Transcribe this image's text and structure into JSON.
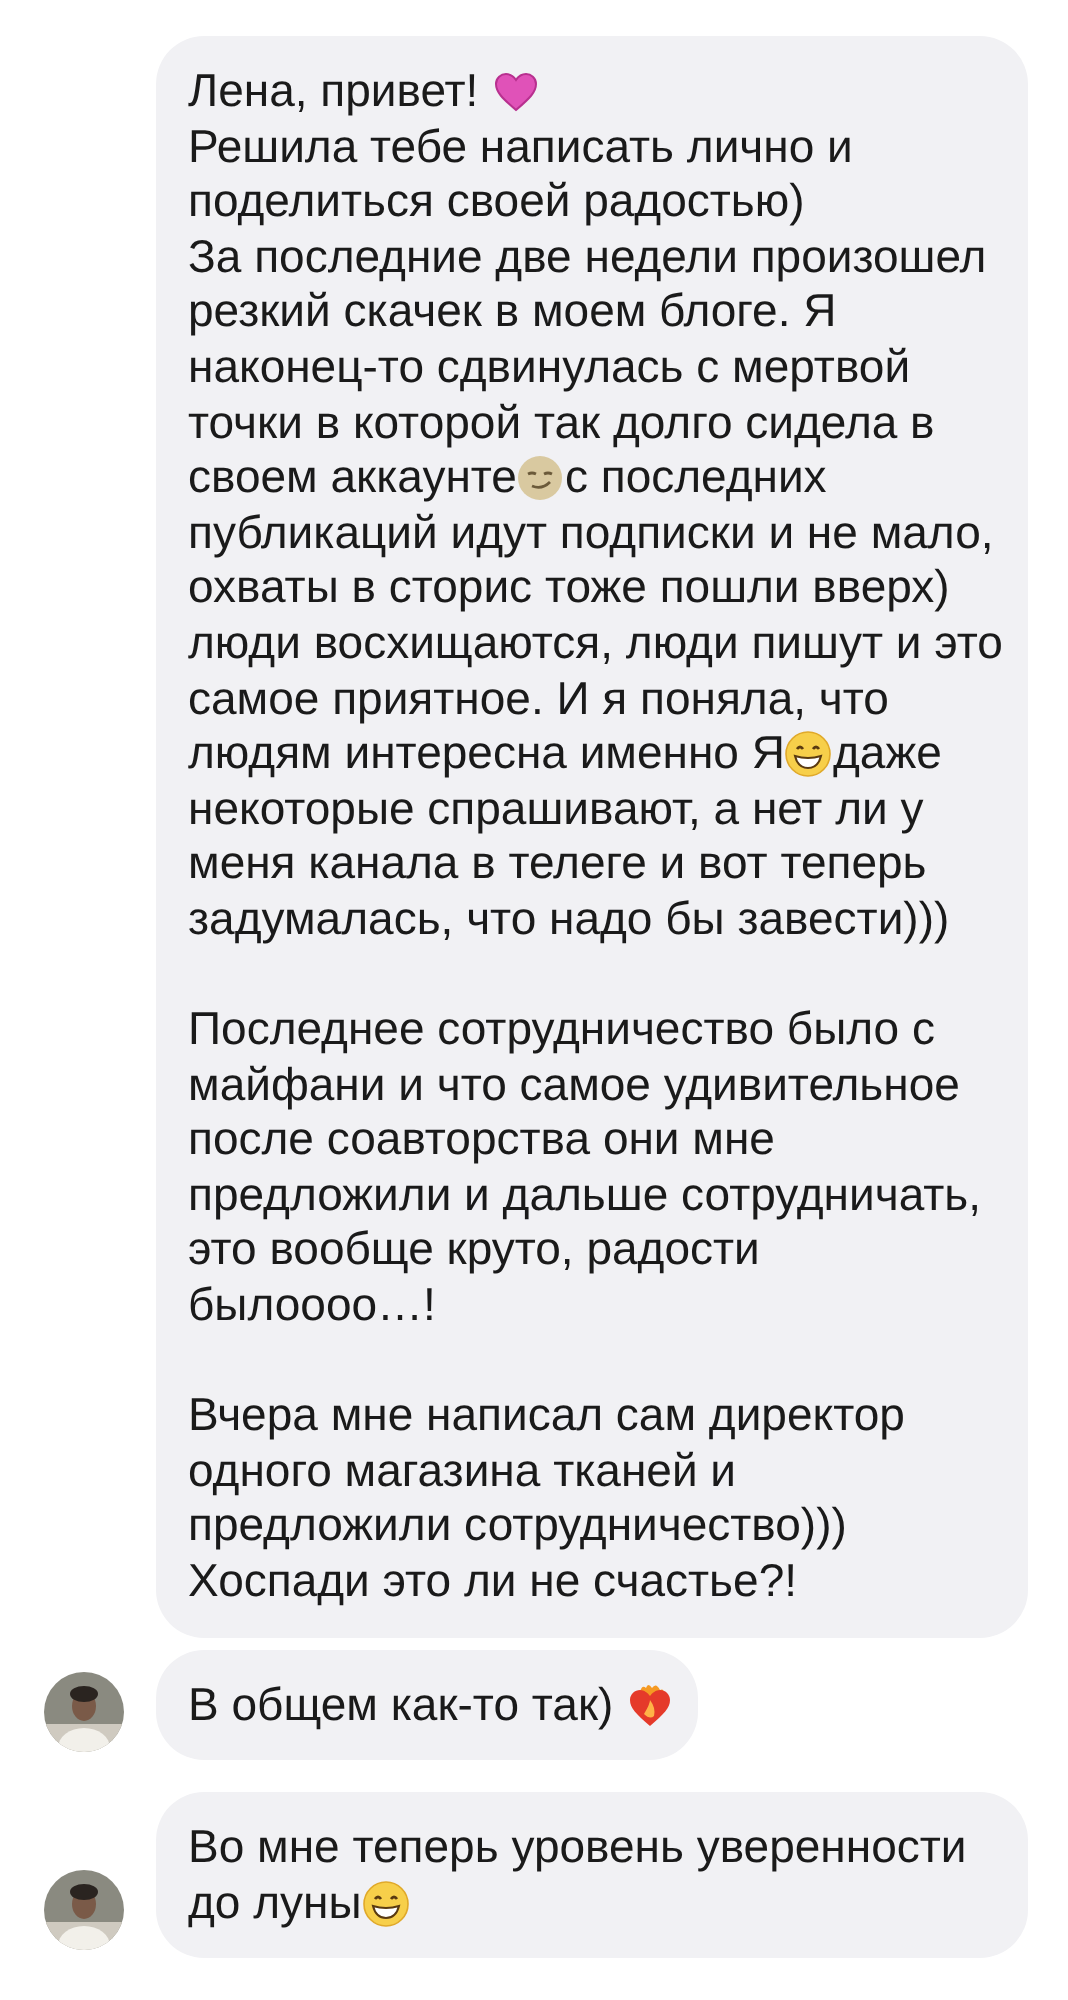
{
  "messages": [
    {
      "avatar": false,
      "segments": [
        {
          "kind": "text",
          "text": "Лена, привет! "
        },
        {
          "kind": "heart"
        },
        {
          "kind": "text",
          "text": "\nРешила тебе написать лично и поделиться своей радостью)\nЗа последние две недели произошел резкий скачек в моем блоге. Я наконец-то сдвинулась с мертвой точки в которой так долго сидела в своем аккаунте"
        },
        {
          "kind": "smirk"
        },
        {
          "kind": "text",
          "text": "с последних публикаций идут подписки и не мало, охваты в сторис тоже пошли вверх) люди восхищаются, люди пишут и это самое приятное. И я поняла, что людям интересна именно Я"
        },
        {
          "kind": "grin"
        },
        {
          "kind": "text",
          "text": "даже некоторые спрашивают, а нет ли у меня канала в телеге и вот теперь задумалась, что надо бы завести)))\n\nПоследнее сотрудничество было с майфани и что самое удивительное после соавторства они мне предложили и дальше сотрудничать, это вообще круто, радости былоооо…!\n\nВчера мне написал сам директор одного магазина тканей и предложили сотрудничество))) Хоспади это ли не счастье?!"
        }
      ]
    },
    {
      "avatar": true,
      "segments": [
        {
          "kind": "text",
          "text": "В общем как-то так) "
        },
        {
          "kind": "fire-heart"
        }
      ]
    },
    {
      "avatar": true,
      "segments": [
        {
          "kind": "text",
          "text": "Во мне теперь уровень уверенности до луны"
        },
        {
          "kind": "grin"
        }
      ]
    }
  ]
}
